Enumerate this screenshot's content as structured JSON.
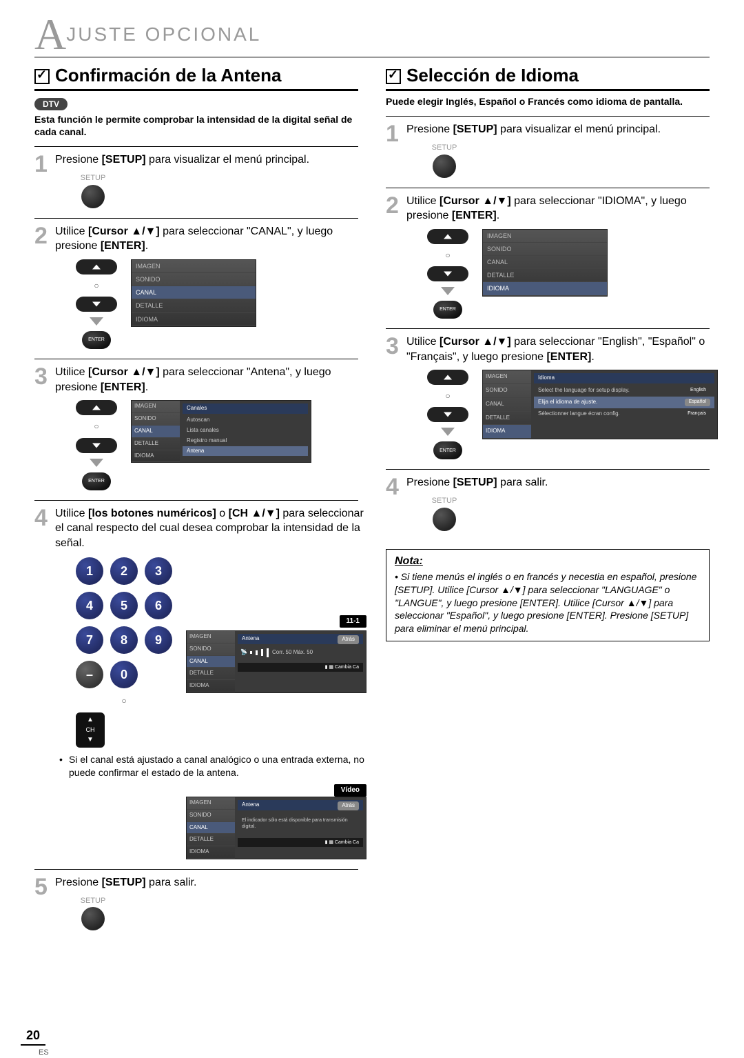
{
  "header": {
    "big": "A",
    "rest": "JUSTE   OPCIONAL"
  },
  "left": {
    "title": "Confirmación de la Antena",
    "dtv": "DTV",
    "desc": "Esta función le permite comprobar la intensidad de la digital señal de cada canal.",
    "s1": {
      "t": "Presione [SETUP] para visualizar el menú principal.",
      "lbl": "SETUP"
    },
    "s2": {
      "p1": "Utilice ",
      "b1": "[Cursor ▲/▼]",
      "p2": " para seleccionar \"CANAL\", y luego presione ",
      "b2": "[ENTER]",
      "p3": ".",
      "enter": "ENTER",
      "m": [
        "IMAGEN",
        "SONIDO",
        "CANAL",
        "DETALLE",
        "IDIOMA"
      ],
      "hl": 2
    },
    "s3": {
      "p1": "Utilice ",
      "b1": "[Cursor ▲/▼]",
      "p2": " para seleccionar \"Antena\", y luego presione ",
      "b2": "[ENTER]",
      "p3": ".",
      "enter": "ENTER",
      "title": "Canales",
      "items": [
        "Autoscan",
        "Lista canales",
        "Registro manual",
        "Antena"
      ],
      "hl": 3
    },
    "s4": {
      "p1": "Utilice ",
      "b1": "[los botones numéricos]",
      "p2": " o ",
      "b2": "[CH ▲/▼]",
      "p3": " para seleccionar el canal respecto del cual desea comprobar la intensidad de la señal.",
      "keys": [
        "1",
        "2",
        "3",
        "4",
        "5",
        "6",
        "7",
        "8",
        "9",
        "–",
        "0"
      ],
      "ch": "CH",
      "badge": "11-1",
      "osd": {
        "title": "Antena",
        "back": "Atrás",
        "sig": "Corr.  50  Máx.   50",
        "foot": "Cambia Ca"
      }
    },
    "note": "Si el canal está ajustado a canal analógico o una entrada externa, no puede confirmar el estado de la antena.",
    "vbadge": "Vídeo",
    "osd2": {
      "title": "Antena",
      "back": "Atrás",
      "msg": "El indicador sólo está disponible para transmisión digital.",
      "foot": "Cambia Ca"
    },
    "s5": {
      "t": "Presione [SETUP] para salir.",
      "lbl": "SETUP"
    }
  },
  "right": {
    "title": "Selección de Idioma",
    "desc": "Puede elegir Inglés, Español o Francés como idioma de pantalla.",
    "s1": {
      "t": "Presione [SETUP] para visualizar el menú principal.",
      "lbl": "SETUP"
    },
    "s2": {
      "p1": "Utilice ",
      "b1": "[Cursor ▲/▼]",
      "p2": " para seleccionar \"IDIOMA\", y luego presione ",
      "b2": "[ENTER]",
      "p3": ".",
      "enter": "ENTER",
      "m": [
        "IMAGEN",
        "SONIDO",
        "CANAL",
        "DETALLE",
        "IDIOMA"
      ],
      "hl": 4
    },
    "s3": {
      "p1": "Utilice ",
      "b1": "[Cursor ▲/▼]",
      "p2": " para seleccionar \"English\", \"Español\" o \"Français\", y luego presione ",
      "b2": "[ENTER]",
      "p3": ".",
      "enter": "ENTER",
      "title": "Idioma",
      "rows": [
        {
          "l": "Select the language for setup display.",
          "o": "English"
        },
        {
          "l": "Elija el idioma de ajuste.",
          "o": "Español"
        },
        {
          "l": "Sélectionner langue écran config.",
          "o": "Français"
        }
      ],
      "hl": 1
    },
    "s4": {
      "t": "Presione [SETUP] para salir.",
      "lbl": "SETUP"
    },
    "note": {
      "hd": "Nota:",
      "body": "Si tiene menús el inglés o en francés y necestia en español, presione [SETUP]. Utilice [Cursor ▲/▼] para seleccionar \"LANGUAGE\" o \"LANGUE\", y luego presione [ENTER]. Utilice [Cursor ▲/▼] para seleccionar \"Español\", y luego presione [ENTER]. Presione [SETUP] para eliminar el menú principal."
    }
  },
  "page": "20",
  "es": "ES"
}
